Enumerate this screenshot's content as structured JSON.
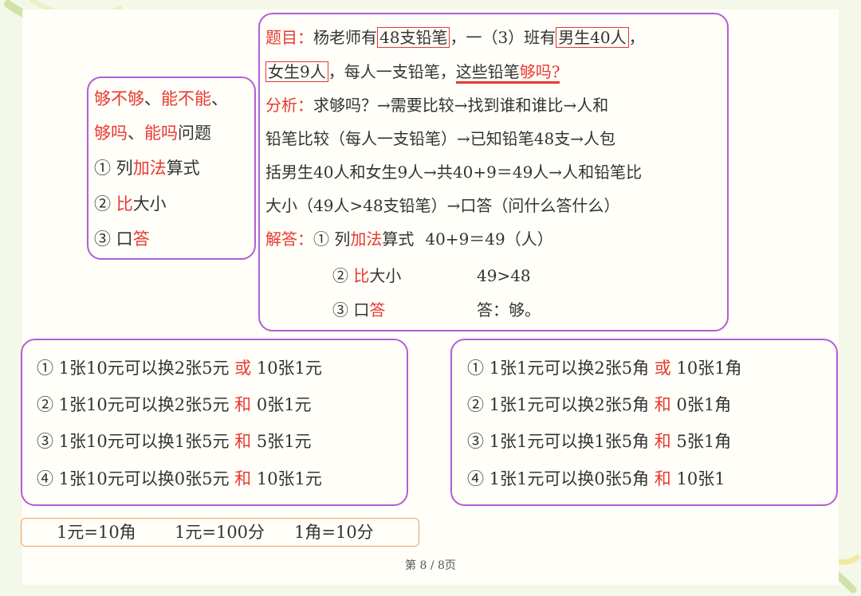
{
  "summary": {
    "line1_a": "够不够",
    "line1_sep": "、",
    "line1_b": "能不能",
    "line1_c": "、",
    "line2_a": "够吗",
    "line2_sep": "、",
    "line2_b": "能吗",
    "line2_c": "问题",
    "step1_num": "①",
    "step1_a": " 列",
    "step1_b": "加法",
    "step1_c": "算式",
    "step2_num": "②",
    "step2_b": "比",
    "step2_c": "大小",
    "step3_num": "③",
    "step3_a": " 口",
    "step3_b": "答"
  },
  "problem": {
    "label": "题目：",
    "t1": "杨老师有",
    "t2": "48支铅笔",
    "t3": "，一（3）班有",
    "t4": "男生40人",
    "t5": "，",
    "t6": "女生9人",
    "t7": "，每人一支铅笔，",
    "t8": "这些铅笔",
    "t9": "够吗?",
    "analysis_label": "分析：",
    "analysis1": "求够吗？→需要比较→找到谁和谁比→人和",
    "analysis2": "铅笔比较（每人一支铅笔）→已知铅笔48支→人包",
    "analysis3": "括男生40人和女生9人→共40+9＝49人→人和铅笔比",
    "analysis4": "大小（49人>48支铅笔）→口答（问什么答什么）",
    "answer_label": "解答：",
    "ans1_a": "① 列",
    "ans1_b": "加法",
    "ans1_c": "算式",
    "ans1_val": "40+9＝49（人）",
    "ans2_a": "② ",
    "ans2_b": "比",
    "ans2_c": "大小",
    "ans2_val": "49>48",
    "ans3_a": "③ 口",
    "ans3_b": "答",
    "ans3_val": "答：够。"
  },
  "exchange_yuan": [
    {
      "a": "① 1张10元可以换2张5元 ",
      "k": "或",
      "b": " 10张1元"
    },
    {
      "a": "② 1张10元可以换2张5元 ",
      "k": "和",
      "b": " 0张1元"
    },
    {
      "a": "③ 1张10元可以换1张5元 ",
      "k": "和",
      "b": " 5张1元"
    },
    {
      "a": "④ 1张10元可以换0张5元 ",
      "k": "和",
      "b": " 10张1元"
    }
  ],
  "exchange_jiao": [
    {
      "a": "① 1张1元可以换2张5角 ",
      "k": "或",
      "b": " 10张1角"
    },
    {
      "a": "② 1张1元可以换2张5角 ",
      "k": "和",
      "b": " 0张1角"
    },
    {
      "a": "③ 1张1元可以换1张5角 ",
      "k": "和",
      "b": " 5张1角"
    },
    {
      "a": "④ 1张1元可以换0张5角 ",
      "k": "和",
      "b": " 10张1"
    }
  ],
  "units": {
    "u1": "1元=10角",
    "u2": "1元=100分",
    "u3": "1角=10分"
  },
  "footer": "第 8 / 8页",
  "colors": {
    "accent_red": "#e8382e",
    "frame_purple": "#b45cd6",
    "unit_orange": "#f0a35a"
  }
}
